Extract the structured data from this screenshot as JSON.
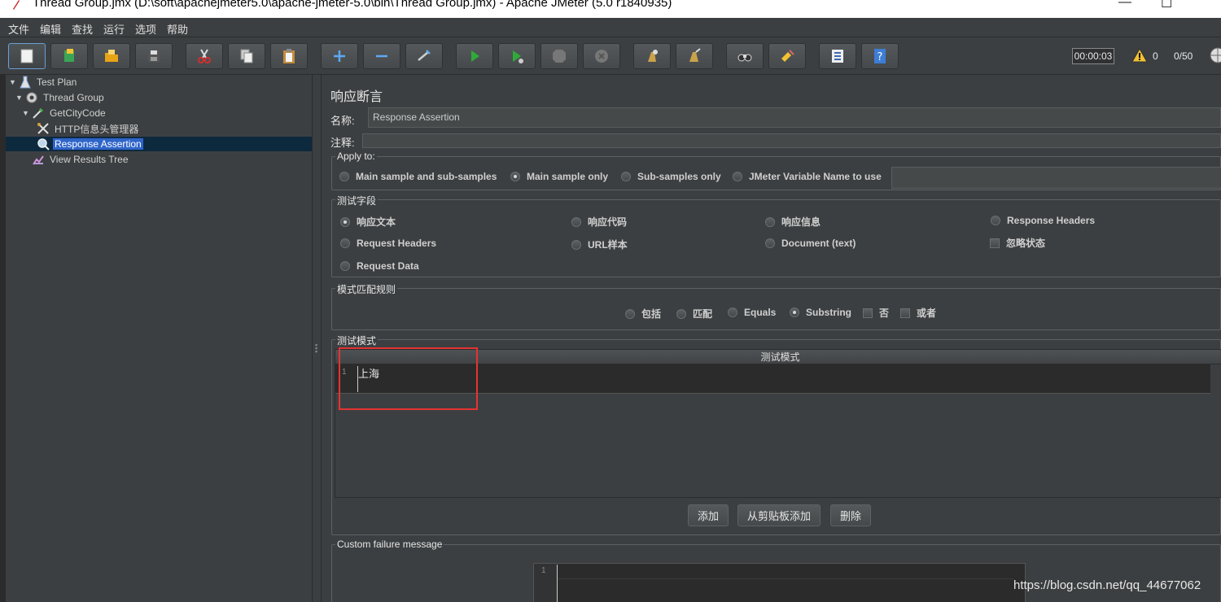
{
  "window": {
    "title": "Thread Group.jmx (D:\\soft\\apachejmeter5.0\\apache-jmeter-5.0\\bin\\Thread Group.jmx) - Apache JMeter (5.0 r1840935)"
  },
  "menu": [
    "文件",
    "编辑",
    "查找",
    "运行",
    "选项",
    "帮助"
  ],
  "toolbar": {
    "timer": "00:00:03",
    "warning_count": "0",
    "threads": "0/50"
  },
  "tree": {
    "items": [
      {
        "label": "Test Plan"
      },
      {
        "label": "Thread Group"
      },
      {
        "label": "GetCityCode"
      },
      {
        "label": "HTTP信息头管理器"
      },
      {
        "label": "Response Assertion"
      },
      {
        "label": "View Results Tree"
      }
    ]
  },
  "panel": {
    "title": "响应断言",
    "name_label": "名称:",
    "name_value": "Response Assertion",
    "comment_label": "注释:"
  },
  "apply_to": {
    "legend": "Apply to:",
    "options": [
      "Main sample and sub-samples",
      "Main sample only",
      "Sub-samples only",
      "JMeter Variable Name to use"
    ],
    "selected": "Main sample only"
  },
  "test_field": {
    "legend": "测试字段",
    "options": [
      "响应文本",
      "响应代码",
      "响应信息",
      "Response Headers",
      "Request Headers",
      "URL样本",
      "Document (text)",
      "忽略状态",
      "Request Data"
    ],
    "selected": "响应文本"
  },
  "pattern_rules": {
    "legend": "模式匹配规则",
    "options": [
      "包括",
      "匹配",
      "Equals",
      "Substring",
      "否",
      "或者"
    ],
    "selected": "Substring"
  },
  "patterns": {
    "legend": "测试模式",
    "column_header": "测试模式",
    "rows": [
      {
        "line": "1",
        "value": "上海"
      }
    ],
    "buttons": {
      "add": "添加",
      "add_clipboard": "从剪贴板添加",
      "delete": "删除"
    }
  },
  "failure": {
    "legend": "Custom failure message",
    "line": "1"
  },
  "watermark": "https://blog.csdn.net/qq_44677062"
}
